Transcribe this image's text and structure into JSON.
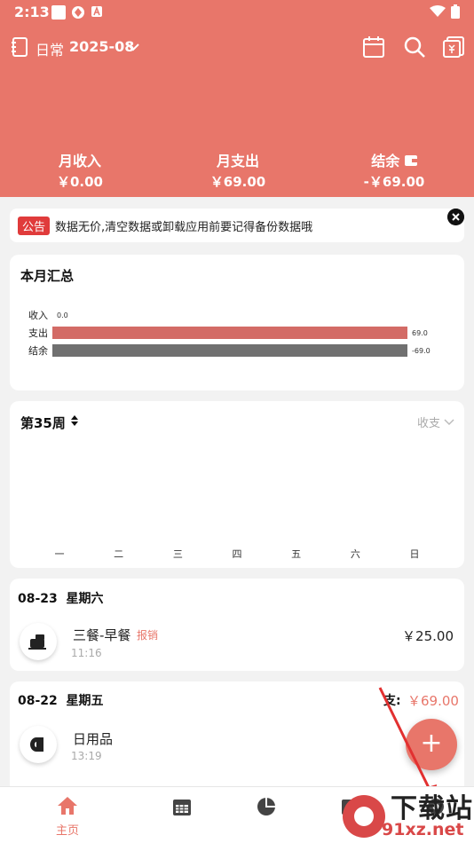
{
  "status_bar": {
    "time": "2:13"
  },
  "topbar": {
    "book": "日常",
    "month": "2025-08"
  },
  "summary": {
    "income_label": "月收入",
    "income_value": "￥0.00",
    "expense_label": "月支出",
    "expense_value": "￥69.00",
    "balance_label": "结余",
    "balance_value": "-￥69.00"
  },
  "notice": {
    "tag": "公告",
    "text": "数据无价,清空数据或卸载应用前要记得备份数据哦"
  },
  "monthly": {
    "title": "本月汇总",
    "rows": [
      {
        "label": "收入",
        "value": 0.0,
        "display": "0.0"
      },
      {
        "label": "支出",
        "value": 69.0,
        "display": "69.0"
      },
      {
        "label": "结余",
        "value": -69.0,
        "display": "-69.0"
      }
    ]
  },
  "weekly": {
    "title": "第35周",
    "filter": "收支",
    "weekdays": [
      "一",
      "二",
      "三",
      "四",
      "五",
      "六",
      "日"
    ]
  },
  "records": [
    {
      "date": "08-23",
      "weekday": "星期六",
      "items": [
        {
          "name": "三餐-早餐",
          "tag": "报销",
          "time": "11:16",
          "amount": "￥25.00"
        }
      ]
    },
    {
      "date": "08-22",
      "weekday": "星期五",
      "total_label": "支:",
      "total": "￥69.00",
      "items": [
        {
          "name": "日用品",
          "time": "13:19"
        }
      ]
    }
  ],
  "fab": {
    "label": "+"
  },
  "bottom_nav": [
    {
      "label": "主页"
    }
  ],
  "watermark": {
    "brand": "下载站",
    "url": "91xz.net"
  },
  "colors": {
    "accent": "#e8766a",
    "expense_bar": "#d36b66",
    "balance_bar": "#707070",
    "tag_red": "#e03b3b"
  }
}
